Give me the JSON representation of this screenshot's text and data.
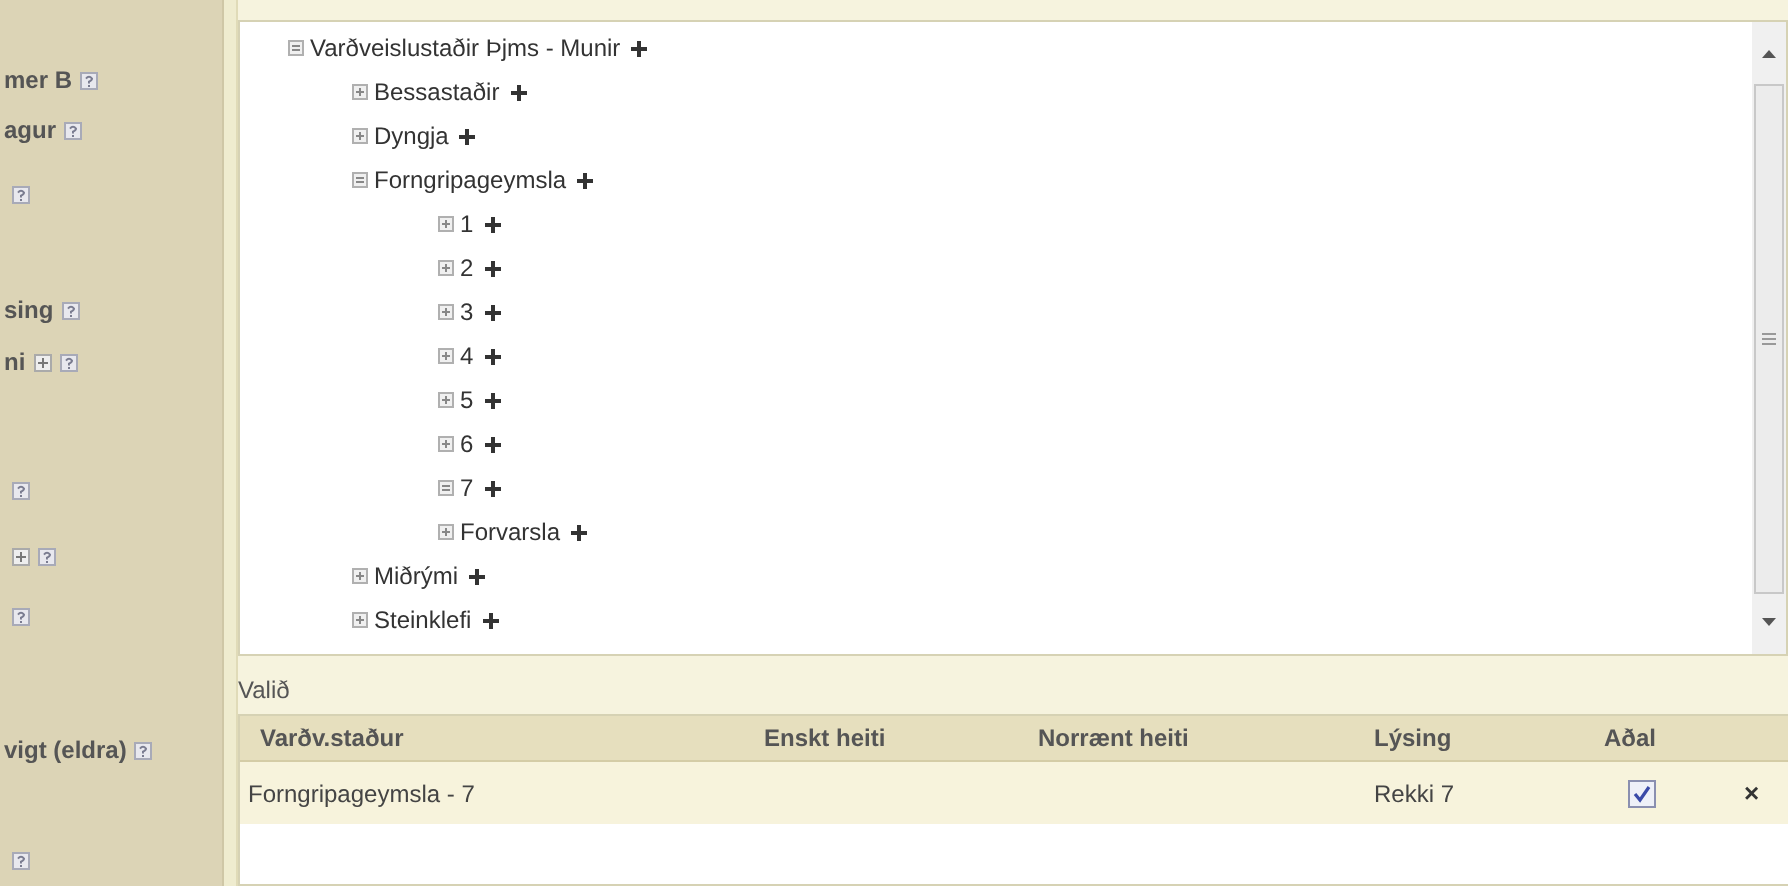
{
  "sidebar": {
    "items": [
      {
        "label": "mer B",
        "plus": false,
        "help": true
      },
      {
        "label": "agur",
        "plus": false,
        "help": true
      },
      {
        "plus": false,
        "help": true
      },
      {
        "label": "sing",
        "plus": false,
        "help": true
      },
      {
        "label": "ni",
        "plus": true,
        "help": true
      },
      {
        "plus": false,
        "help": true
      },
      {
        "plus": true,
        "help": true
      },
      {
        "plus": false,
        "help": true
      },
      {
        "label": "vigt (eldra)",
        "plus": false,
        "help": true
      },
      {
        "plus": false,
        "help": true
      }
    ]
  },
  "tree": {
    "nodes": [
      {
        "label": "Varðveislustaðir Þjms - Munir",
        "expanded": true,
        "children": [
          {
            "label": "Bessastaðir",
            "expanded": false
          },
          {
            "label": "Dyngja",
            "expanded": false
          },
          {
            "label": "Forngripageymsla",
            "expanded": true,
            "children": [
              {
                "label": "1",
                "expanded": false
              },
              {
                "label": "2",
                "expanded": false
              },
              {
                "label": "3",
                "expanded": false
              },
              {
                "label": "4",
                "expanded": false
              },
              {
                "label": "5",
                "expanded": false
              },
              {
                "label": "6",
                "expanded": false
              },
              {
                "label": "7",
                "expanded": true
              },
              {
                "label": "Forvarsla",
                "expanded": false
              }
            ]
          },
          {
            "label": "Miðrými",
            "expanded": false
          },
          {
            "label": "Steinklefi",
            "expanded": false
          }
        ]
      }
    ]
  },
  "selected": {
    "title": "Valið",
    "columns": [
      "Varðv.staður",
      "Enskt heiti",
      "Norrænt heiti",
      "Lýsing",
      "Aðal"
    ],
    "rows": [
      {
        "cells": [
          "Forngripageymsla - 7",
          "",
          "",
          "Rekki 7"
        ],
        "main": true,
        "remove": "×"
      }
    ]
  }
}
